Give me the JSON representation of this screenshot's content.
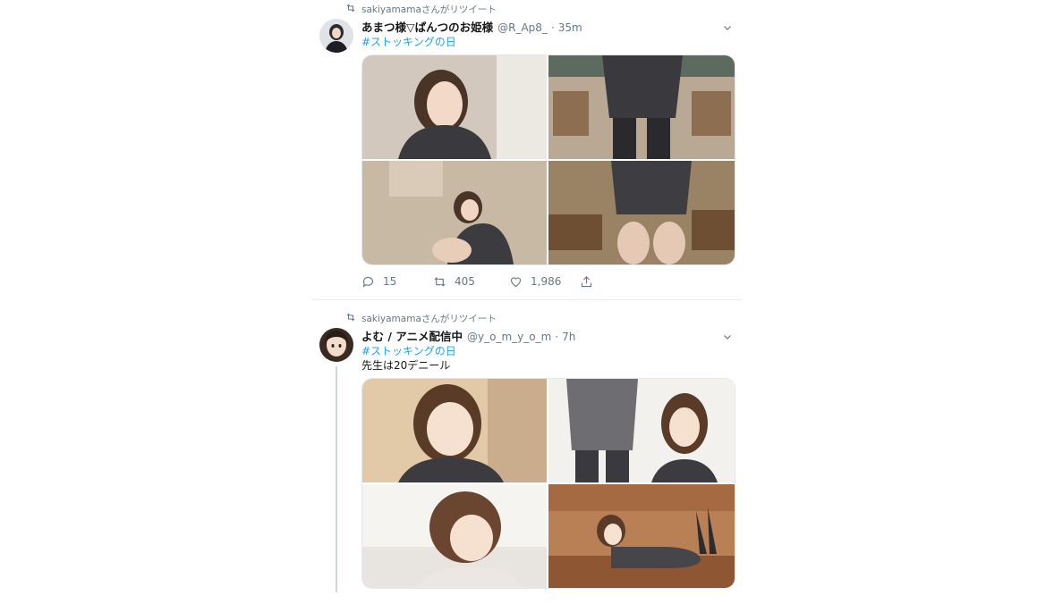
{
  "tweets": [
    {
      "retweeted_by": "sakiyamamaさんがリツイート",
      "author_name": "あまつ様▽ぱんつのお姫様",
      "handle": "@R_Ap8_",
      "separator": "·",
      "time": "35m",
      "hashtag": "#ストッキングの日",
      "text": "",
      "media": [
        {
          "icon": "photo-woman-glasses"
        },
        {
          "icon": "photo-classroom-skirt"
        },
        {
          "icon": "photo-low-angle-woman"
        },
        {
          "icon": "photo-skirt-desk"
        }
      ],
      "replies": "15",
      "retweets": "405",
      "likes": "1,986"
    },
    {
      "retweeted_by": "sakiyamamaさんがリツイート",
      "author_name": "よむ / アニメ配信中",
      "handle": "@y_o_m_y_o_m",
      "separator": "·",
      "time": "7h",
      "hashtag": "#ストッキングの日",
      "text": "先生は20デニール",
      "media": [
        {
          "icon": "illustration-teacher-face"
        },
        {
          "icon": "illustration-teacher-back"
        },
        {
          "icon": "illustration-teacher-lean"
        },
        {
          "icon": "illustration-teacher-sofa"
        }
      ]
    }
  ],
  "colors": {
    "accent": "#1da1f2",
    "muted": "#657786",
    "text": "#14171a",
    "divider": "#e6ecf0"
  }
}
